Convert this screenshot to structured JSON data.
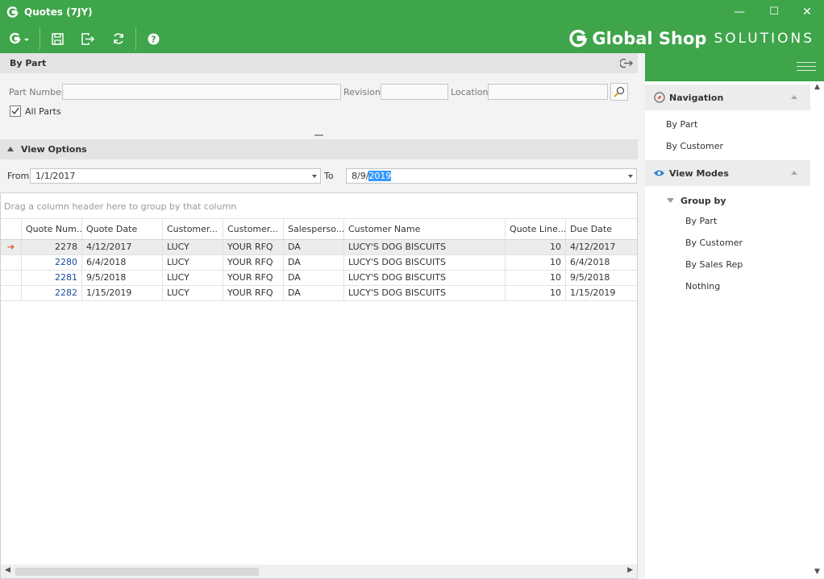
{
  "window": {
    "title": "Quotes (7JY)",
    "minimize_glyph": "—",
    "maximize_glyph": "☐",
    "close_glyph": "✕"
  },
  "brand": {
    "bold": "Global Shop",
    "light": "SOLUTIONS"
  },
  "toolbar": {
    "icons": [
      "g-menu-icon",
      "save-icon",
      "exit-icon",
      "refresh-icon",
      "help-icon"
    ]
  },
  "by_part": {
    "title": "By Part",
    "part_number_label": "Part Number",
    "part_number_value": "",
    "revision_label": "Revision",
    "revision_value": "",
    "location_label": "Location",
    "location_value": "",
    "all_parts_label": "All Parts",
    "all_parts_checked": true
  },
  "view_options": {
    "title": "View Options",
    "from_label": "From",
    "from_value": "1/1/2017",
    "to_label": "To",
    "to_value_prefix": "8/9/",
    "to_value_selected": "2019"
  },
  "grid": {
    "group_hint": "Drag a column header here to group by that column",
    "columns": [
      "Quote Num...",
      "Quote Date",
      "Customer...",
      "Customer...",
      "Salesperso...",
      "Customer Name",
      "Quote Line...",
      "Due Date"
    ],
    "rows": [
      [
        "2278",
        "4/12/2017",
        "LUCY",
        "YOUR RFQ",
        "DA",
        "LUCY'S DOG BISCUITS",
        "10",
        "4/12/2017"
      ],
      [
        "2280",
        "6/4/2018",
        "LUCY",
        "YOUR RFQ",
        "DA",
        "LUCY'S DOG BISCUITS",
        "10",
        "6/4/2018"
      ],
      [
        "2281",
        "9/5/2018",
        "LUCY",
        "YOUR RFQ",
        "DA",
        "LUCY'S DOG BISCUITS",
        "10",
        "9/5/2018"
      ],
      [
        "2282",
        "1/15/2019",
        "LUCY",
        "YOUR RFQ",
        "DA",
        "LUCY'S DOG BISCUITS",
        "10",
        "1/15/2019"
      ]
    ],
    "current_row_indicator": "➔"
  },
  "navigation": {
    "title": "Navigation",
    "items": [
      "By Part",
      "By Customer"
    ]
  },
  "view_modes": {
    "title": "View Modes",
    "group_by_label": "Group by",
    "items": [
      "By Part",
      "By Customer",
      "By Sales Rep",
      "Nothing"
    ]
  },
  "colors": {
    "accent": "#3ea54a",
    "link": "#1a4ea0",
    "selection": "#3399ff"
  }
}
